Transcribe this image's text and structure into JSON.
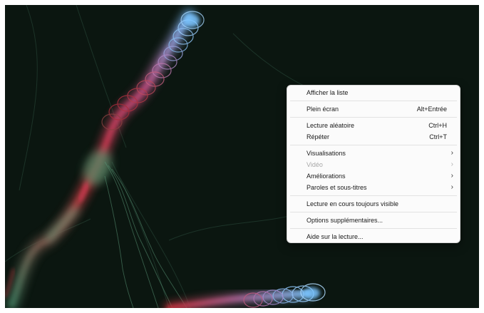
{
  "context_menu": {
    "items": [
      {
        "label": "Afficher la liste"
      },
      {
        "label": "Plein écran",
        "shortcut": "Alt+Entrée"
      },
      {
        "label": "Lecture aléatoire",
        "shortcut": "Ctrl+H"
      },
      {
        "label": "Répéter",
        "shortcut": "Ctrl+T"
      },
      {
        "label": "Visualisations",
        "submenu_icon": "chevron-right-icon"
      },
      {
        "label": "Vidéo",
        "submenu_icon": "chevron-right-icon",
        "disabled": true
      },
      {
        "label": "Améliorations",
        "submenu_icon": "chevron-right-icon"
      },
      {
        "label": "Paroles et sous-titres",
        "submenu_icon": "chevron-right-icon"
      },
      {
        "label": "Lecture en cours toujours visible"
      },
      {
        "label": "Options supplémentaires..."
      },
      {
        "label": "Aide sur la lecture..."
      }
    ],
    "chevron_glyph": "›"
  },
  "colors": {
    "background": "#0b1610",
    "menu_background": "#fbfbfb",
    "disabled_text": "#a8a8a8",
    "viz_blue": "#6fb6f0",
    "viz_red": "#c0303a",
    "viz_green": "#4f8a68"
  }
}
